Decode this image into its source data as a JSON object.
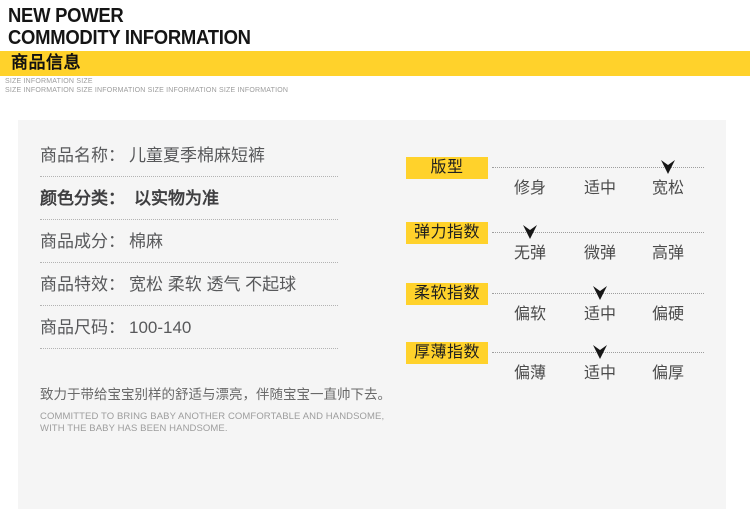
{
  "header": {
    "title_line1": "NEW POWER",
    "title_line2": "COMMODITY INFORMATION",
    "banner_label": "商品信息",
    "sub_line1": "SIZE INFORMATION SIZE",
    "sub_line2": "SIZE INFORMATION SIZE INFORMATION SIZE INFORMATION SIZE INFORMATION"
  },
  "colors": {
    "accent_yellow": "#FFD22B",
    "card_background": "#F5F5F5",
    "brand_text": "#151515",
    "spec_text": "#58595B",
    "muted_text": "#9C9C9C"
  },
  "product": {
    "rows": [
      {
        "label": "商品名称：",
        "value": "儿童夏季棉麻短裤",
        "bold": false
      },
      {
        "label": "颜色分类：",
        "value": "以实物为准",
        "bold": true
      },
      {
        "label": "商品成分：",
        "value": "棉麻",
        "bold": false
      },
      {
        "label": "商品特效：",
        "value": "宽松 柔软 透气 不起球",
        "bold": false
      },
      {
        "label": "商品尺码：",
        "value": "100-140",
        "bold": false
      }
    ],
    "tagline_cn": "致力于带给宝宝别样的舒适与漂亮，伴随宝宝一直帅下去。",
    "tagline_en_line1": "COMMITTED TO BRING BABY ANOTHER COMFORTABLE AND HANDSOME,",
    "tagline_en_line2": "WITH THE BABY HAS BEEN HANDSOME."
  },
  "indicators": [
    {
      "label": "版型",
      "options": [
        "修身",
        "适中",
        "宽松"
      ],
      "selected_index": 2
    },
    {
      "label": "弹力指数",
      "options": [
        "无弹",
        "微弹",
        "高弹"
      ],
      "selected_index": 0
    },
    {
      "label": "柔软指数",
      "options": [
        "偏软",
        "适中",
        "偏硬"
      ],
      "selected_index": 1
    },
    {
      "label": "厚薄指数",
      "options": [
        "偏薄",
        "适中",
        "偏厚"
      ],
      "selected_index": 1
    }
  ]
}
